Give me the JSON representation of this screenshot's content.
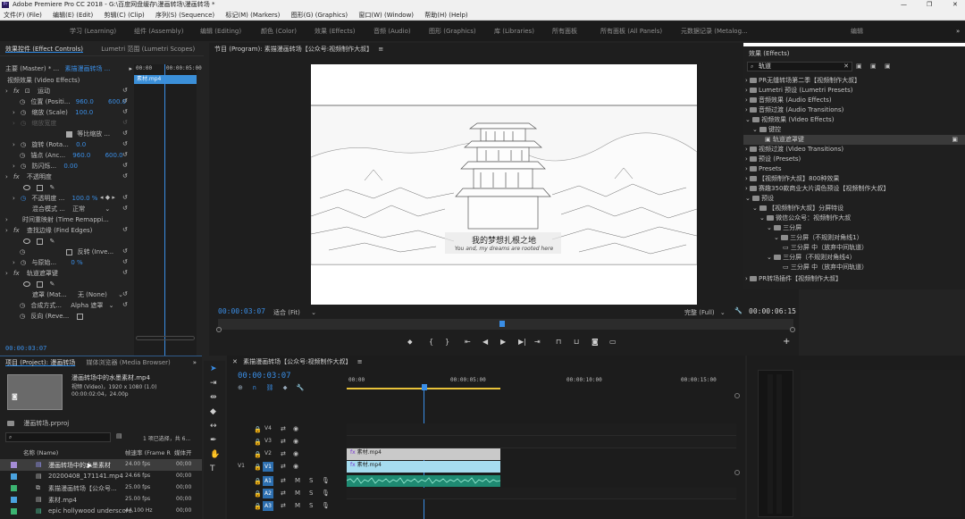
{
  "app": {
    "title": "Adobe Premiere Pro CC 2018 - G:\\百度网盘缓存\\漫画转场\\漫画转场 *",
    "win_min": "—",
    "win_max": "❐",
    "win_close": "✕"
  },
  "menu": [
    "文件(F) (File)",
    "编辑(E) (Edit)",
    "剪辑(C) (Clip)",
    "序列(S) (Sequence)",
    "标记(M) (Markers)",
    "图形(G) (Graphics)",
    "窗口(W) (Window)",
    "帮助(H) (Help)"
  ],
  "workspaces": [
    "学习 (Learning)",
    "组件 (Assembly)",
    "编辑 (Editing)",
    "颜色 (Color)",
    "效果 (Effects)",
    "音频 (Audio)",
    "图形 (Graphics)",
    "库 (Libraries)",
    "所有面板",
    "所有面板 (All Panels)",
    "元数据记录 (Metalog..."
  ],
  "ws_overflow": "»",
  "ws_extra": "编辑",
  "effect_controls": {
    "tab_active": "效果控件 (Effect Controls)",
    "tab_other": "Lumetri 范围 (Lumetri Scopes)",
    "master": "主要 (Master) * ...",
    "seq": "素描漫画转场 ...",
    "mini_time": "00:00",
    "mini_time2": "00:00:05:00",
    "clip_name": "素材.mp4",
    "video_effects": "视频效果 (Video Effects)",
    "motion": "运动",
    "position_label": "位置 (Positi...",
    "position_x": "960.0",
    "position_y": "600.0",
    "scale_label": "缩放 (Scale)",
    "scale_val": "100.0",
    "scale_w_label": "缩放宽度",
    "uniform_label": "等比缩放 ...",
    "rotation_label": "旋转 (Rota...",
    "rotation_val": "0.0",
    "anchor_label": "锚点 (Anc...",
    "anchor_x": "960.0",
    "anchor_y": "600.0",
    "flicker_label": "防闪烁...",
    "flicker_val": "0.00",
    "opacity": "不透明度",
    "opacity_label": "不透明度 ...",
    "opacity_val": "100.0 %",
    "blend_label": "混合模式 ...",
    "blend_val": "正常",
    "time_remap": "时间重映射 (Time Remappi...",
    "find_edges": "查找边缘 (Find Edges)",
    "invert_label": "反转 (Inve...",
    "blend_orig_label": "与原始...",
    "blend_orig_val": "0 %",
    "track_matte": "轨道遮罩键",
    "matte_label": "遮罩 (Mat...",
    "matte_val": "无 (None)",
    "composite_label": "合成方式...",
    "composite_val": "Alpha 遮罩",
    "reverse_label": "反向 (Reve...",
    "timecode": "00:00:03:07"
  },
  "program": {
    "title": "节目 (Program): 素描漫画转场【公众号:视频制作大叔】",
    "menu_icon": "≡",
    "subtitle_cn": "我的梦想扎根之地",
    "subtitle_en": "You and, my dreams are rooted here",
    "timecode": "00:00:03:07",
    "fit": "适合 (Fit)",
    "quality": "完整 (Full)",
    "duration": "00:00:06:15"
  },
  "effects_panel": {
    "title": "效果 (Effects)",
    "search_value": "轨道",
    "items": [
      "PR无缝转场第二季【视频制作大叔】",
      "Lumetri 预设 (Lumetri Presets)",
      "音频效果 (Audio Effects)",
      "音频过渡 (Audio Transitions)",
      "视频效果 (Video Effects)",
      "键控",
      "轨道遮罩键",
      "视频过渡 (Video Transitions)",
      "预设 (Presets)",
      "Presets",
      "【视频制作大叔】800种效果",
      "赛趣350款商业大片调色预设【视频制作大叔】",
      "预设",
      "【视频制作大叔】分屏特设",
      "微信公众号：视频制作大叔",
      "三分屏",
      "三分屏（不规则对角线1）",
      "三分屏 中（放弃中间轨道）",
      "三分屏（不规则对角线4）",
      "三分屏 中（放弃中间轨道）",
      "PR转场插件【视频制作大叔】"
    ]
  },
  "project": {
    "tab_active": "项目 (Project): 漫画转场",
    "tab_other": "媒体浏览器 (Media Browser)",
    "overflow": "»",
    "preview_name": "漫画转场中的水墨素材.mp4",
    "preview_info1": "视频 (Video)，1920 x 1080 (1.0)",
    "preview_info2": "00:00:02:04，24.00p",
    "prproj": "漫画转场.prproj",
    "selection": "1 项已选择，共 6...",
    "col_name": "名称 (Name)",
    "col_fps": "帧速率 (Frame R",
    "col_media": "媒体开",
    "rows": [
      {
        "name": "漫画转场中的水墨素材",
        "fps": "24.00 fps",
        "start": "00;00",
        "color": "#a58cd6"
      },
      {
        "name": "20200408_171141.mp4",
        "fps": "24.66 fps",
        "start": "00;00",
        "color": "#4aa3df"
      },
      {
        "name": "素描漫画转场【公众号...",
        "fps": "25.00 fps",
        "start": "00;00",
        "color": "#3cb371"
      },
      {
        "name": "素材.mp4",
        "fps": "25.00 fps",
        "start": "00;00",
        "color": "#4aa3df"
      },
      {
        "name": "epic hollywood underscore",
        "fps": "44,100 Hz",
        "start": "00;00",
        "color": "#3cb371"
      }
    ]
  },
  "timeline": {
    "title": "素描漫画转场【公众号:视频制作大叔】",
    "menu_icon": "≡",
    "timecode": "00:00:03:07",
    "ruler": [
      "00:00",
      "00:00:05:00",
      "00:00:10:00",
      "00:00:15:00"
    ],
    "tracks_v": [
      "V4",
      "V3",
      "V2",
      "V1"
    ],
    "tracks_a": [
      "A1",
      "A2",
      "A3"
    ],
    "v1_src": "V1",
    "clip_v2": "素材.mp4",
    "clip_v1": "素材.mp4"
  },
  "colors": {
    "accent": "#2d8ceb",
    "timecode": "#3a8ee6",
    "clip_video": "#a6dcef",
    "clip_audio": "#2aa58b",
    "workarea": "#e8c23a"
  }
}
